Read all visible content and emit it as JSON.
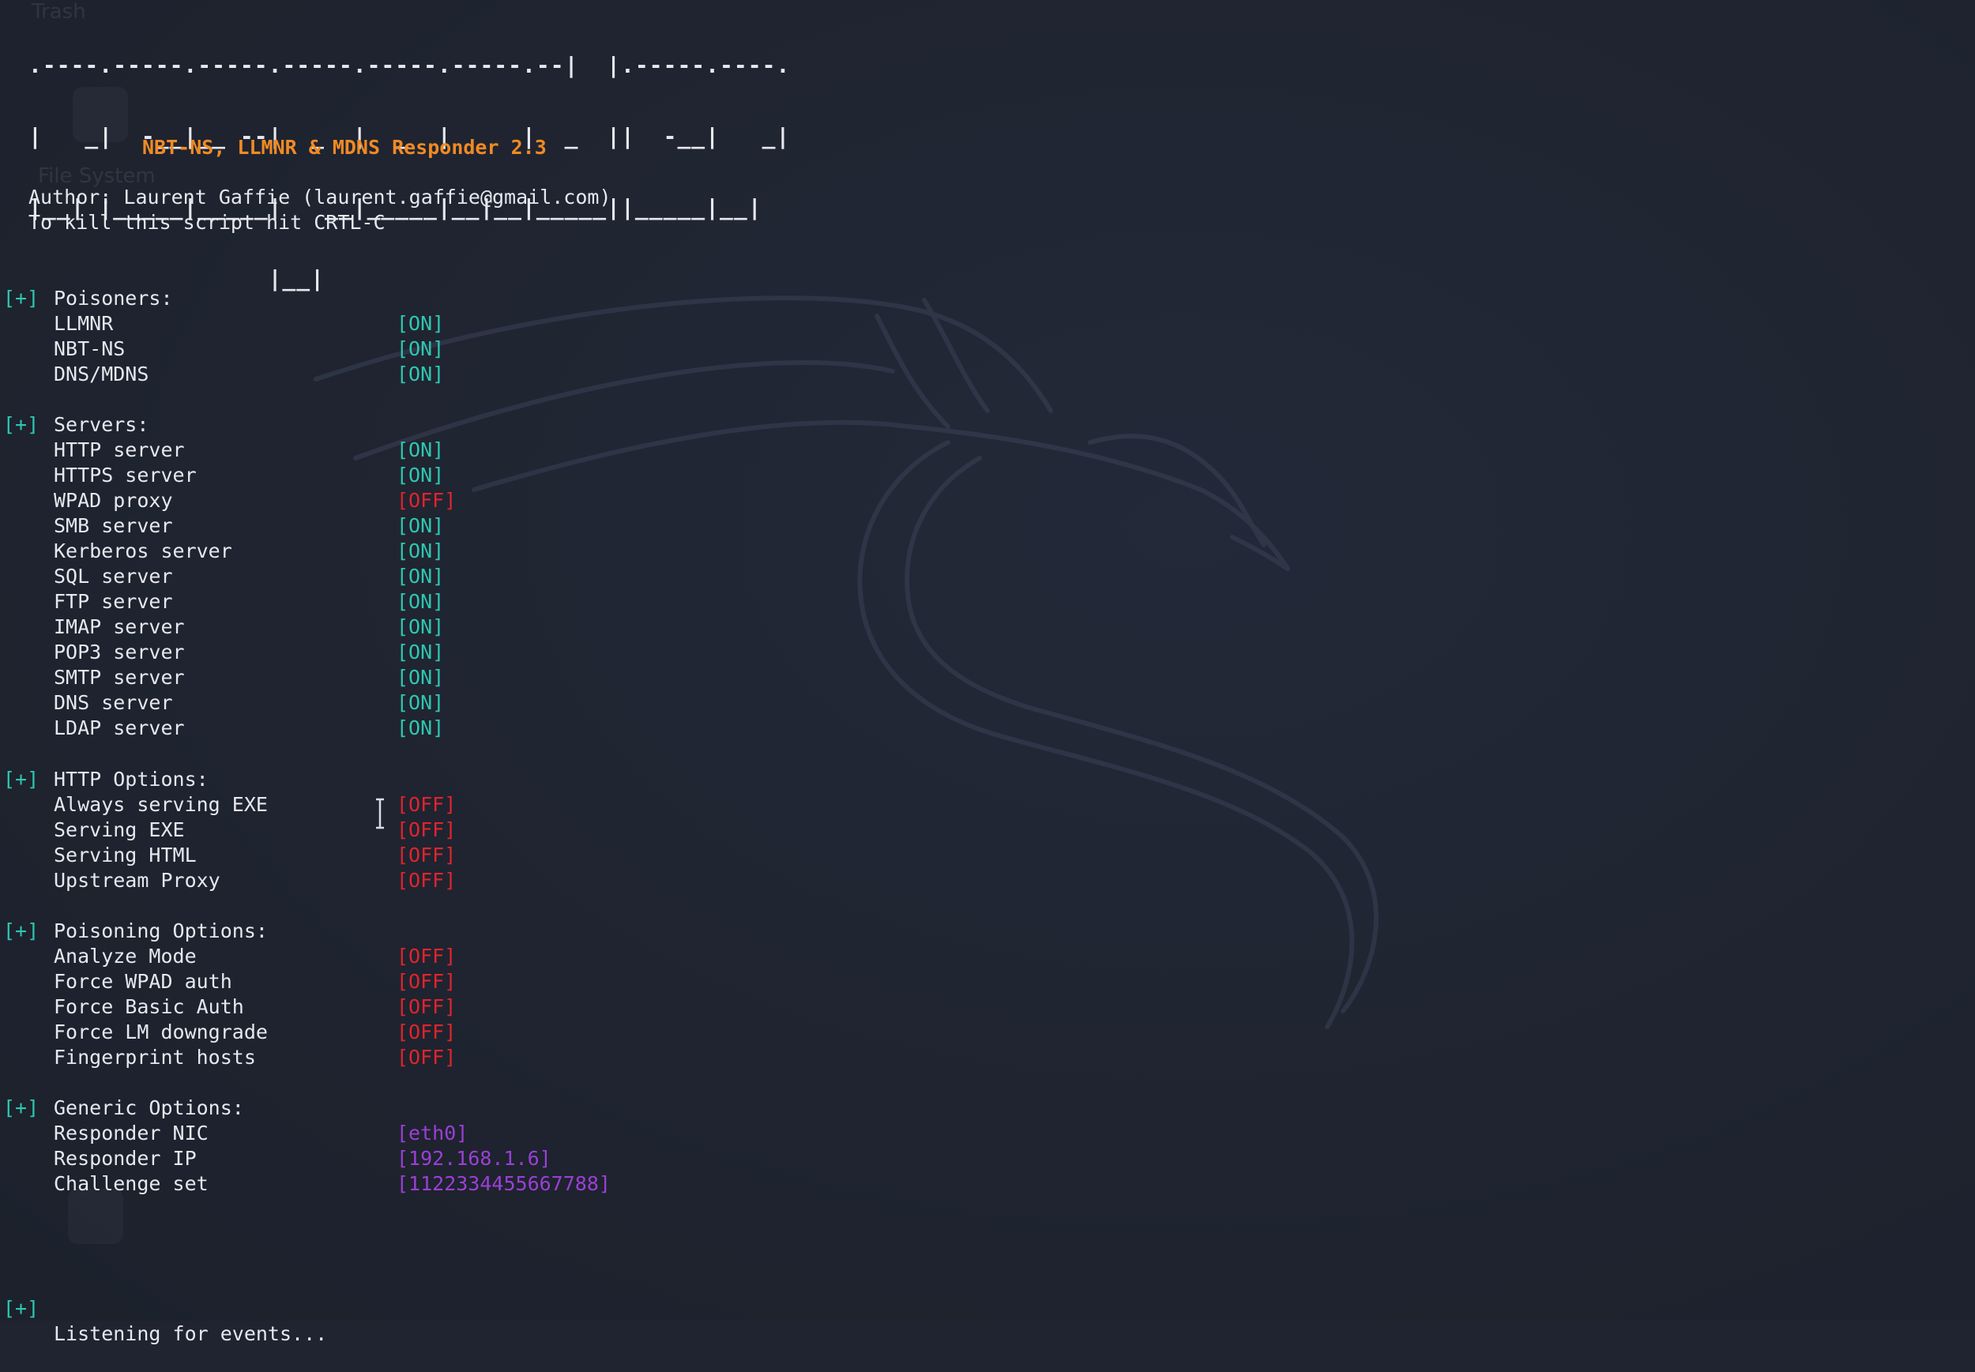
{
  "banner": [
    ".----.-----.-----.-----.-----.-----.--|  |.-----.----.",
    "|   _|  -__|__ --|  _  |  _  |     |  _  ||  -__|   _|",
    "|__| |_____|_____|   __|_____|__|__|_____||_____|__|",
    "                 |__|"
  ],
  "title": "NBT-NS, LLMNR & MDNS Responder 2.3",
  "author": "Author: Laurent Gaffie (laurent.gaffie@gmail.com)",
  "kill_hint": "To kill this script hit CRTL-C",
  "marker": "[+]",
  "sections": {
    "poisoners": {
      "header": "Poisoners:",
      "items": [
        {
          "label": "LLMNR",
          "value": "[ON]"
        },
        {
          "label": "NBT-NS",
          "value": "[ON]"
        },
        {
          "label": "DNS/MDNS",
          "value": "[ON]"
        }
      ]
    },
    "servers": {
      "header": "Servers:",
      "items": [
        {
          "label": "HTTP server",
          "value": "[ON]"
        },
        {
          "label": "HTTPS server",
          "value": "[ON]"
        },
        {
          "label": "WPAD proxy",
          "value": "[OFF]"
        },
        {
          "label": "SMB server",
          "value": "[ON]"
        },
        {
          "label": "Kerberos server",
          "value": "[ON]"
        },
        {
          "label": "SQL server",
          "value": "[ON]"
        },
        {
          "label": "FTP server",
          "value": "[ON]"
        },
        {
          "label": "IMAP server",
          "value": "[ON]"
        },
        {
          "label": "POP3 server",
          "value": "[ON]"
        },
        {
          "label": "SMTP server",
          "value": "[ON]"
        },
        {
          "label": "DNS server",
          "value": "[ON]"
        },
        {
          "label": "LDAP server",
          "value": "[ON]"
        }
      ]
    },
    "http_options": {
      "header": "HTTP Options:",
      "items": [
        {
          "label": "Always serving EXE",
          "value": "[OFF]"
        },
        {
          "label": "Serving EXE",
          "value": "[OFF]"
        },
        {
          "label": "Serving HTML",
          "value": "[OFF]"
        },
        {
          "label": "Upstream Proxy",
          "value": "[OFF]"
        }
      ]
    },
    "poisoning_options": {
      "header": "Poisoning Options:",
      "items": [
        {
          "label": "Analyze Mode",
          "value": "[OFF]"
        },
        {
          "label": "Force WPAD auth",
          "value": "[OFF]"
        },
        {
          "label": "Force Basic Auth",
          "value": "[OFF]"
        },
        {
          "label": "Force LM downgrade",
          "value": "[OFF]"
        },
        {
          "label": "Fingerprint hosts",
          "value": "[OFF]"
        }
      ]
    },
    "generic_options": {
      "header": "Generic Options:",
      "items": [
        {
          "label": "Responder NIC",
          "value": "[eth0]"
        },
        {
          "label": "Responder IP",
          "value": "[192.168.1.6]"
        },
        {
          "label": "Challenge set",
          "value": "[1122334455667788]"
        }
      ]
    }
  },
  "listening": "Listening for events...",
  "colors": {
    "background": "#1f2430",
    "text": "#e6e8ee",
    "marker": "#2ec7b0",
    "on": "#2ec7b0",
    "off": "#e0242d",
    "generic_value": "#9b3fd6",
    "title": "#f08a24"
  }
}
